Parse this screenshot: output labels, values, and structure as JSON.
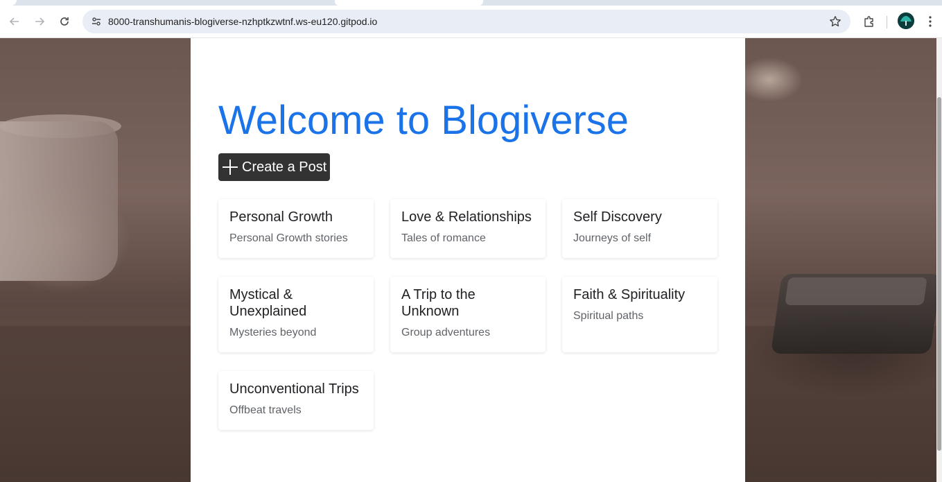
{
  "browser": {
    "url": "8000-transhumanis-blogiverse-nzhptkzwtnf.ws-eu120.gitpod.io"
  },
  "page": {
    "title": "Welcome to Blogiverse",
    "create_button_label": "Create a Post",
    "categories": [
      {
        "title": "Personal Growth",
        "description": "Personal Growth stories"
      },
      {
        "title": "Love & Relationships",
        "description": "Tales of romance"
      },
      {
        "title": "Self Discovery",
        "description": "Journeys of self"
      },
      {
        "title": "Mystical & Unexplained",
        "description": "Mysteries beyond"
      },
      {
        "title": "A Trip to the Unknown",
        "description": "Group adventures"
      },
      {
        "title": "Faith & Spirituality",
        "description": "Spiritual paths"
      },
      {
        "title": "Unconventional Trips",
        "description": "Offbeat travels"
      }
    ]
  },
  "colors": {
    "accent": "#1a73e8",
    "button": "#333333"
  }
}
